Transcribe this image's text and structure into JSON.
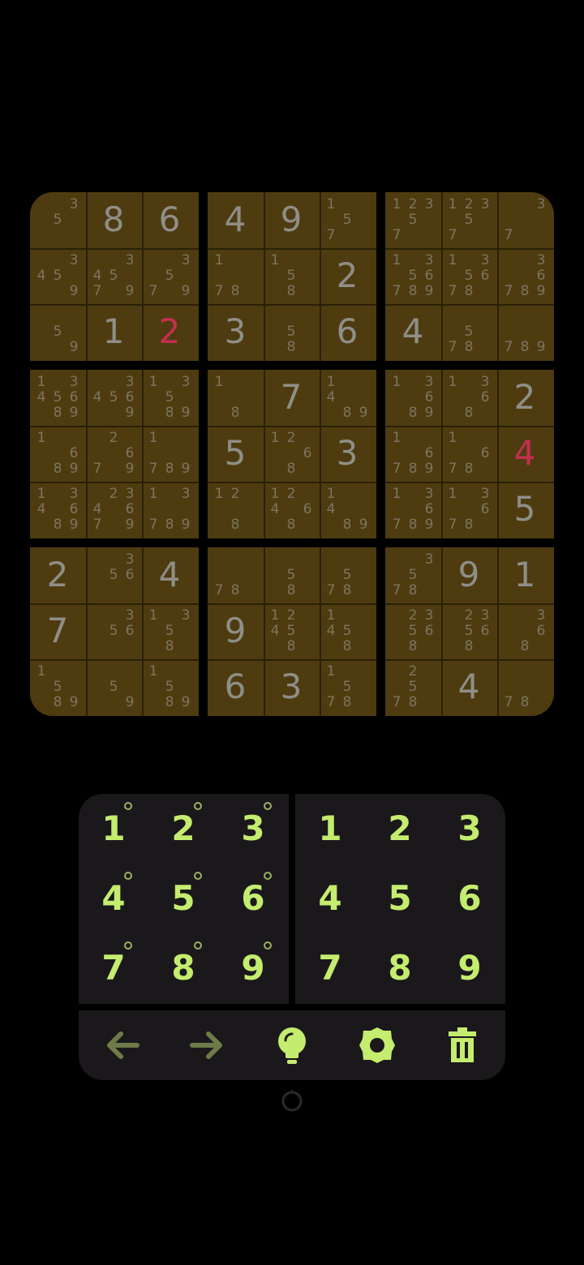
{
  "board": [
    [
      {
        "v": "",
        "n": "35"
      },
      {
        "v": "8",
        "n": ""
      },
      {
        "v": "6",
        "n": ""
      },
      {
        "v": "4",
        "n": ""
      },
      {
        "v": "9",
        "n": ""
      },
      {
        "v": "",
        "n": "157"
      },
      {
        "v": "",
        "n": "12357"
      },
      {
        "v": "",
        "n": "12357"
      },
      {
        "v": "",
        "n": "37"
      }
    ],
    [
      {
        "v": "",
        "n": "3459"
      },
      {
        "v": "",
        "n": "34579"
      },
      {
        "v": "",
        "n": "3579"
      },
      {
        "v": "",
        "n": "178"
      },
      {
        "v": "",
        "n": "158"
      },
      {
        "v": "2",
        "n": ""
      },
      {
        "v": "",
        "n": "1356789"
      },
      {
        "v": "",
        "n": "135678"
      },
      {
        "v": "",
        "n": "36789"
      }
    ],
    [
      {
        "v": "",
        "n": "59"
      },
      {
        "v": "1",
        "n": ""
      },
      {
        "v": "2",
        "n": "",
        "error": true
      },
      {
        "v": "3",
        "n": ""
      },
      {
        "v": "",
        "n": "58"
      },
      {
        "v": "6",
        "n": ""
      },
      {
        "v": "4",
        "n": ""
      },
      {
        "v": "",
        "n": "578"
      },
      {
        "v": "",
        "n": "789"
      }
    ],
    [
      {
        "v": "",
        "n": "1345689"
      },
      {
        "v": "",
        "n": "34569"
      },
      {
        "v": "",
        "n": "13589"
      },
      {
        "v": "",
        "n": "18"
      },
      {
        "v": "7",
        "n": ""
      },
      {
        "v": "",
        "n": "1489"
      },
      {
        "v": "",
        "n": "13689"
      },
      {
        "v": "",
        "n": "1368"
      },
      {
        "v": "2",
        "n": ""
      }
    ],
    [
      {
        "v": "",
        "n": "1689"
      },
      {
        "v": "",
        "n": "2679"
      },
      {
        "v": "",
        "n": "1789"
      },
      {
        "v": "5",
        "n": ""
      },
      {
        "v": "",
        "n": "1268"
      },
      {
        "v": "3",
        "n": ""
      },
      {
        "v": "",
        "n": "16789"
      },
      {
        "v": "",
        "n": "1678"
      },
      {
        "v": "4",
        "n": "",
        "error": true
      }
    ],
    [
      {
        "v": "",
        "n": "134689"
      },
      {
        "v": "",
        "n": "234679"
      },
      {
        "v": "",
        "n": "13789"
      },
      {
        "v": "",
        "n": "128"
      },
      {
        "v": "",
        "n": "12468"
      },
      {
        "v": "",
        "n": "1489"
      },
      {
        "v": "",
        "n": "136789"
      },
      {
        "v": "",
        "n": "13678"
      },
      {
        "v": "5",
        "n": ""
      }
    ],
    [
      {
        "v": "2",
        "n": ""
      },
      {
        "v": "",
        "n": "356"
      },
      {
        "v": "4",
        "n": ""
      },
      {
        "v": "",
        "n": "78"
      },
      {
        "v": "",
        "n": "58"
      },
      {
        "v": "",
        "n": "578"
      },
      {
        "v": "",
        "n": "3578"
      },
      {
        "v": "9",
        "n": ""
      },
      {
        "v": "1",
        "n": ""
      }
    ],
    [
      {
        "v": "7",
        "n": ""
      },
      {
        "v": "",
        "n": "356"
      },
      {
        "v": "",
        "n": "1358"
      },
      {
        "v": "9",
        "n": ""
      },
      {
        "v": "",
        "n": "12458"
      },
      {
        "v": "",
        "n": "1458"
      },
      {
        "v": "",
        "n": "23568"
      },
      {
        "v": "",
        "n": "23568"
      },
      {
        "v": "",
        "n": "368"
      }
    ],
    [
      {
        "v": "",
        "n": "1589"
      },
      {
        "v": "",
        "n": "59"
      },
      {
        "v": "",
        "n": "1589"
      },
      {
        "v": "6",
        "n": ""
      },
      {
        "v": "3",
        "n": ""
      },
      {
        "v": "",
        "n": "1578"
      },
      {
        "v": "",
        "n": "2578"
      },
      {
        "v": "4",
        "n": ""
      },
      {
        "v": "",
        "n": "78"
      }
    ]
  ],
  "keypad": {
    "notes_keys": [
      "1",
      "2",
      "3",
      "4",
      "5",
      "6",
      "7",
      "8",
      "9"
    ],
    "value_keys": [
      "1",
      "2",
      "3",
      "4",
      "5",
      "6",
      "7",
      "8",
      "9"
    ]
  },
  "toolbar": {
    "buttons": [
      {
        "icon": "arrow-left-icon",
        "name": "undo-button"
      },
      {
        "icon": "arrow-right-icon",
        "name": "redo-button"
      },
      {
        "icon": "lightbulb-icon",
        "name": "hint-button"
      },
      {
        "icon": "gear-icon",
        "name": "settings-button"
      },
      {
        "icon": "trash-icon",
        "name": "delete-button"
      }
    ]
  },
  "colors": {
    "box": "#4e3c10",
    "given": "#8f8e88",
    "error": "#c32f4f",
    "note": "#7d7561",
    "pad": "#1b181c",
    "accent": "#c4ec6e",
    "muted_accent": "#6e7b48"
  }
}
